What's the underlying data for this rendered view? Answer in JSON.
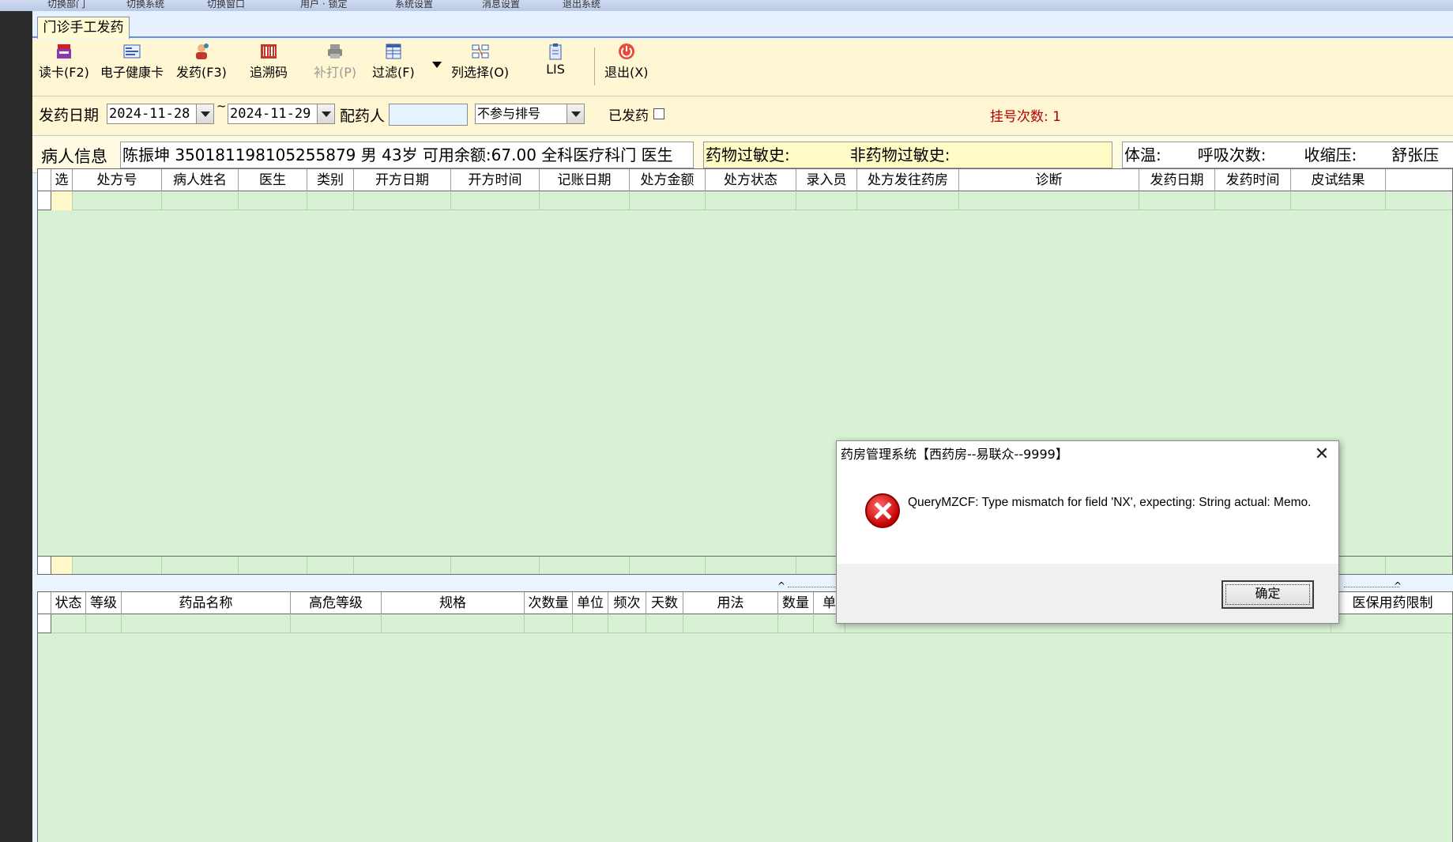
{
  "menubar": {
    "items": [
      "切换部门",
      "切换系统",
      "切换窗口",
      "用户 · 锁定",
      "系统设置",
      "消息设置",
      "退出系统"
    ]
  },
  "tab": {
    "title": "门诊手工发药"
  },
  "toolbar": {
    "read_card": "读卡(F2)",
    "health_card": "电子健康卡",
    "dispense": "发药(F3)",
    "trace_code": "追溯码",
    "reprint": "补打(P)",
    "filter": "过滤(F)",
    "column_select": "列选择(O)",
    "lis": "LIS",
    "exit": "退出(X)"
  },
  "filters": {
    "date_label": "发药日期",
    "date_from": "2024-11-28",
    "date_sep": "~",
    "date_to": "2024-11-29",
    "doser_label": "配药人",
    "doser_value": "",
    "queue_option": "不参与排号",
    "dispensed_label": "已发药",
    "dispensed_checked": false,
    "reg_count_label": "挂号次数: 1"
  },
  "patient": {
    "label": "病人信息",
    "info": "陈振坤 350181198105255879 男 43岁 可用余额:67.00 全科医疗科门 医生",
    "drug_allergy_label": "药物过敏史:",
    "nondrug_allergy_label": "非药物过敏史:",
    "temp_label": "体温:",
    "resp_label": "呼吸次数:",
    "systolic_label": "收缩压:",
    "diastolic_label": "舒张压"
  },
  "rx_grid": {
    "columns": [
      "选",
      "处方号",
      "病人姓名",
      "医生",
      "类别",
      "开方日期",
      "开方时间",
      "记账日期",
      "处方金额",
      "处方状态",
      "录入员",
      "处方发往药房",
      "诊断",
      "发药日期",
      "发药时间",
      "皮试结果"
    ]
  },
  "detail_grid": {
    "columns": [
      "状态",
      "等级",
      "药品名称",
      "高危等级",
      "规格",
      "次数量",
      "单位",
      "频次",
      "天数",
      "用法",
      "数量",
      "单",
      "医保用药限制"
    ]
  },
  "dialog": {
    "title": "药房管理系统【西药房--易联众--9999】",
    "message": "QueryMZCF: Type mismatch for field 'NX', expecting: String actual: Memo.",
    "ok_label": "确定",
    "close_symbol": "✕"
  }
}
